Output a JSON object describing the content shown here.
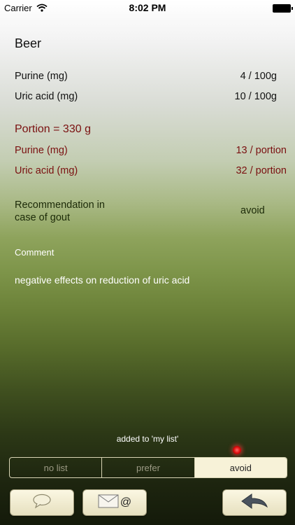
{
  "status_bar": {
    "carrier": "Carrier",
    "time": "8:02 PM"
  },
  "food": {
    "name": "Beer",
    "purine_label": "Purine (mg)",
    "purine_value": "4  / 100g",
    "uric_label": "Uric acid (mg)",
    "uric_value": "10  / 100g"
  },
  "portion": {
    "title": "Portion  =  330 g",
    "purine_label": "Purine (mg)",
    "purine_value": "13  / portion",
    "uric_label": "Uric acid (mg)",
    "uric_value": "32  / portion"
  },
  "recommendation": {
    "label_line1": "Recommendation in",
    "label_line2": "case of gout",
    "value": "avoid"
  },
  "comment": {
    "label": "Comment",
    "text": "negative effects on reduction of uric acid"
  },
  "status_message": "added to 'my list'",
  "list_selector": {
    "options": [
      "no list",
      "prefer",
      "avoid"
    ],
    "selected": "avoid"
  },
  "icons": {
    "comment": "speech-bubble-icon",
    "mail": "envelope-at-icon",
    "back": "back-arrow-icon",
    "indicator": "red-dot-indicator"
  },
  "colors": {
    "portion_red": "#7a1010",
    "recommendation_green": "#1c2a08",
    "segment_active": "#f7f2d8"
  }
}
